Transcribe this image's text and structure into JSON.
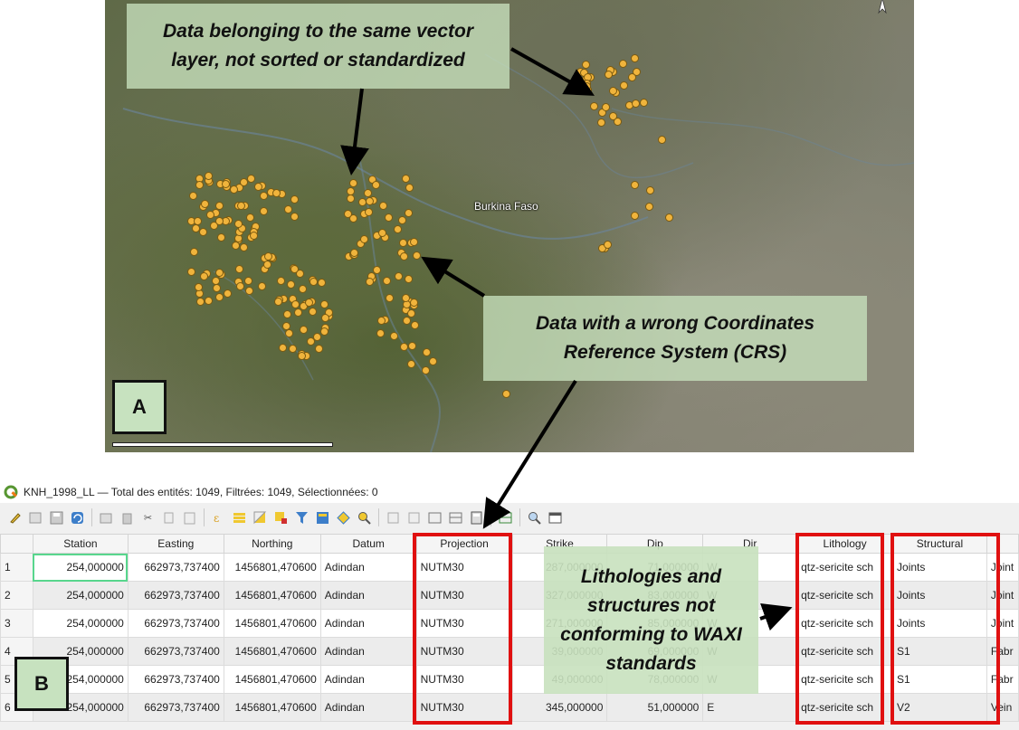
{
  "map": {
    "country_label": "Burkina Faso",
    "panel_label": "A",
    "callout_top": "Data belonging to the same vector layer, not sorted or standardized",
    "callout_crs": "Data with a wrong Coordinates Reference System (CRS)",
    "icons": [
      "north-arrow-icon",
      "scale-bar"
    ]
  },
  "attribute_table": {
    "panel_label": "B",
    "window_title": "KNH_1998_LL — Total des entités: 1049, Filtrées: 1049, Sélectionnées: 0",
    "callout_lithology": "Lithologies and structures not conforming to WAXI standards",
    "toolbar_icons": [
      "edit-pencil-icon",
      "multi-edit-icon",
      "save-icon",
      "reload-icon",
      "add-feature-icon",
      "delete-feature-icon",
      "cut-icon",
      "copy-icon",
      "paste-icon",
      "expression-select-icon",
      "select-all-icon",
      "invert-selection-icon",
      "deselect-icon",
      "filter-icon",
      "move-selection-top-icon",
      "pan-to-selection-icon",
      "zoom-to-selection-icon",
      "copy-rows-icon",
      "paste-rows-icon",
      "delete-field-icon",
      "new-field-icon",
      "field-calculator-icon",
      "conditional-format-icon",
      "zoom-map-icon",
      "dock-icon"
    ],
    "columns": [
      "Station",
      "Easting",
      "Northing",
      "Datum",
      "Projection",
      "Strike",
      "Dip",
      "Dir",
      "Lithology",
      "Structural",
      ""
    ],
    "rows": [
      {
        "n": "1",
        "station": "254,000000",
        "easting": "662973,737400",
        "northing": "1456801,470600",
        "datum": "Adindan",
        "projection": "NUTM30",
        "strike": "287,000000",
        "dip": "71,000000",
        "dir": "W",
        "lithology": "qtz-sericite sch",
        "structural": "Joints",
        "extra": "Joint"
      },
      {
        "n": "2",
        "station": "254,000000",
        "easting": "662973,737400",
        "northing": "1456801,470600",
        "datum": "Adindan",
        "projection": "NUTM30",
        "strike": "327,000000",
        "dip": "83,000000",
        "dir": "W",
        "lithology": "qtz-sericite sch",
        "structural": "Joints",
        "extra": "Joint"
      },
      {
        "n": "3",
        "station": "254,000000",
        "easting": "662973,737400",
        "northing": "1456801,470600",
        "datum": "Adindan",
        "projection": "NUTM30",
        "strike": "271,000000",
        "dip": "85,000000",
        "dir": "W",
        "lithology": "qtz-sericite sch",
        "structural": "Joints",
        "extra": "Joint"
      },
      {
        "n": "4",
        "station": "254,000000",
        "easting": "662973,737400",
        "northing": "1456801,470600",
        "datum": "Adindan",
        "projection": "NUTM30",
        "strike": "39,000000",
        "dip": "69,000000",
        "dir": "W",
        "lithology": "qtz-sericite sch",
        "structural": "S1",
        "extra": "Fabr"
      },
      {
        "n": "5",
        "station": "254,000000",
        "easting": "662973,737400",
        "northing": "1456801,470600",
        "datum": "Adindan",
        "projection": "NUTM30",
        "strike": "49,000000",
        "dip": "78,000000",
        "dir": "W",
        "lithology": "qtz-sericite sch",
        "structural": "S1",
        "extra": "Fabr"
      },
      {
        "n": "6",
        "station": "254,000000",
        "easting": "662973,737400",
        "northing": "1456801,470600",
        "datum": "Adindan",
        "projection": "NUTM30",
        "strike": "345,000000",
        "dip": "51,000000",
        "dir": "E",
        "lithology": "qtz-sericite sch",
        "structural": "V2",
        "extra": "Vein"
      }
    ]
  },
  "colors": {
    "point": "#f0b43c",
    "callout_bg": "#c8e1be",
    "highlight_box": "#e01010",
    "selected_cell": "#58d68d"
  }
}
